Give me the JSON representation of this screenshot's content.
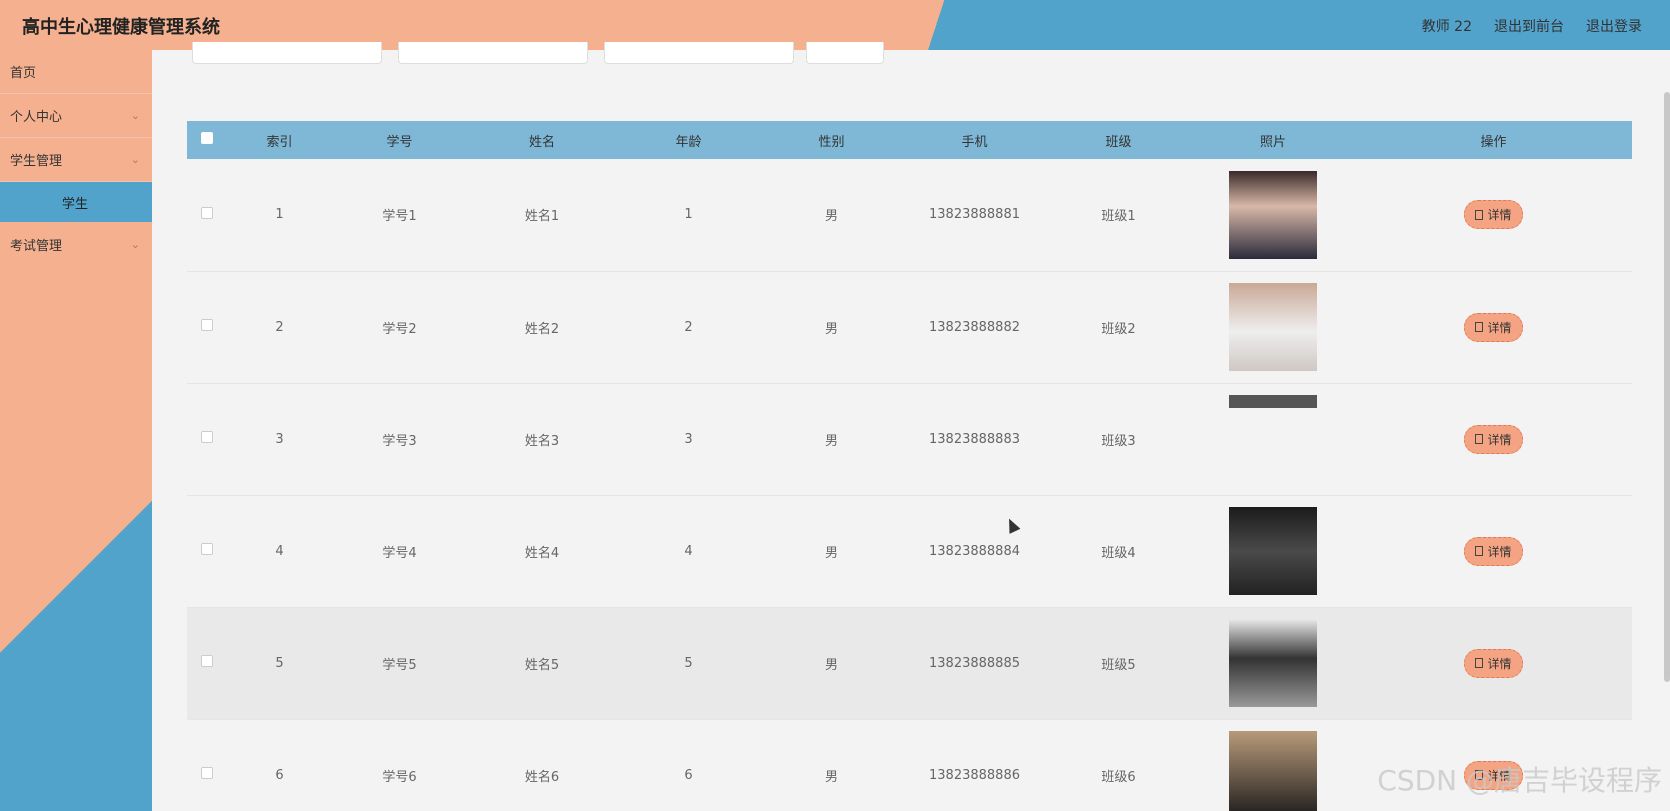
{
  "header": {
    "title": "高中生心理健康管理系统",
    "user": "教师 22",
    "exit_front": "退出到前台",
    "logout": "退出登录"
  },
  "sidebar": {
    "items": [
      {
        "label": "首页",
        "has_chevron": false
      },
      {
        "label": "个人中心",
        "has_chevron": true
      },
      {
        "label": "学生管理",
        "has_chevron": true
      },
      {
        "label": "学生",
        "sub": true,
        "active": true
      },
      {
        "label": "考试管理",
        "has_chevron": true
      }
    ]
  },
  "table": {
    "headers": [
      "索引",
      "学号",
      "姓名",
      "年龄",
      "性别",
      "手机",
      "班级",
      "照片",
      "操作"
    ],
    "rows": [
      {
        "index": "1",
        "id": "学号1",
        "name": "姓名1",
        "age": "1",
        "gender": "男",
        "phone": "13823888881",
        "class": "班级1",
        "action": "详情"
      },
      {
        "index": "2",
        "id": "学号2",
        "name": "姓名2",
        "age": "2",
        "gender": "男",
        "phone": "13823888882",
        "class": "班级2",
        "action": "详情"
      },
      {
        "index": "3",
        "id": "学号3",
        "name": "姓名3",
        "age": "3",
        "gender": "男",
        "phone": "13823888883",
        "class": "班级3",
        "action": "详情"
      },
      {
        "index": "4",
        "id": "学号4",
        "name": "姓名4",
        "age": "4",
        "gender": "男",
        "phone": "13823888884",
        "class": "班级4",
        "action": "详情"
      },
      {
        "index": "5",
        "id": "学号5",
        "name": "姓名5",
        "age": "5",
        "gender": "男",
        "phone": "13823888885",
        "class": "班级5",
        "action": "详情"
      },
      {
        "index": "6",
        "id": "学号6",
        "name": "姓名6",
        "age": "6",
        "gender": "男",
        "phone": "13823888886",
        "class": "班级6",
        "action": "详情"
      }
    ]
  },
  "watermark": "CSDN @唐吉毕设程序",
  "colors": {
    "accent_orange": "#f5b18f",
    "accent_blue": "#52a3cc",
    "table_header": "#7fb8d7"
  }
}
